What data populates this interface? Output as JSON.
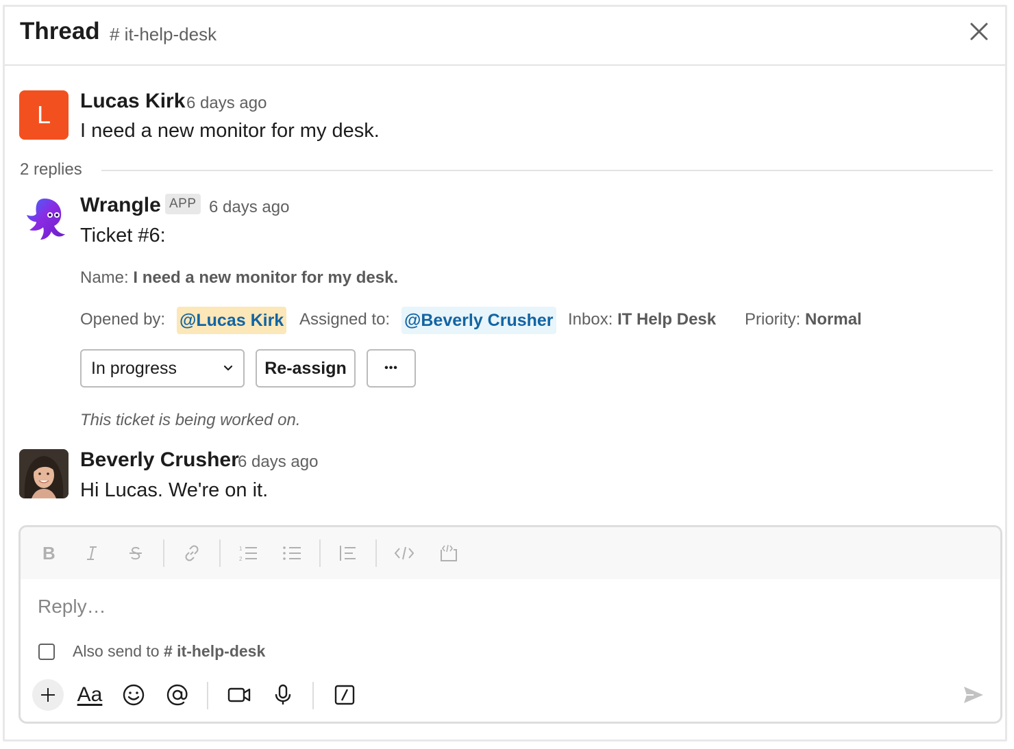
{
  "header": {
    "title": "Thread",
    "channel": "# it-help-desk"
  },
  "parent_message": {
    "avatar_initial": "L",
    "author": "Lucas Kirk",
    "time": "6 days ago",
    "text": "I need a new monitor for my desk."
  },
  "replies_label": "2 replies",
  "bot_message": {
    "author": "Wrangle",
    "badge": "APP",
    "time": "6 days ago",
    "text": "Ticket #6:",
    "name_label": "Name:",
    "name_value": "I need a new monitor for my desk.",
    "opened_by_label": "Opened by:",
    "opened_by": "@Lucas Kirk",
    "assigned_to_label": "Assigned to:",
    "assigned_to": "@Beverly Crusher",
    "inbox_label": "Inbox:",
    "inbox_value": "IT Help Desk",
    "priority_label": "Priority:",
    "priority_value": "Normal",
    "status_select": "In progress",
    "reassign_button": "Re-assign",
    "more_button": "•••",
    "note": "This ticket is being worked on."
  },
  "reply_message": {
    "author": "Beverly Crusher",
    "time": "6 days ago",
    "text": "Hi Lucas. We're on it."
  },
  "composer": {
    "placeholder": "Reply…",
    "also_send_label": "Also send to",
    "also_send_channel": "# it-help-desk",
    "text_format_label": "Aa"
  },
  "colors": {
    "avatar_orange": "#f3501f",
    "mention_self_bg": "#fce7b8",
    "mention_other_bg": "#e8f5fa",
    "mention_text": "#1264a3",
    "brand_purple": "#7b2bd6"
  }
}
